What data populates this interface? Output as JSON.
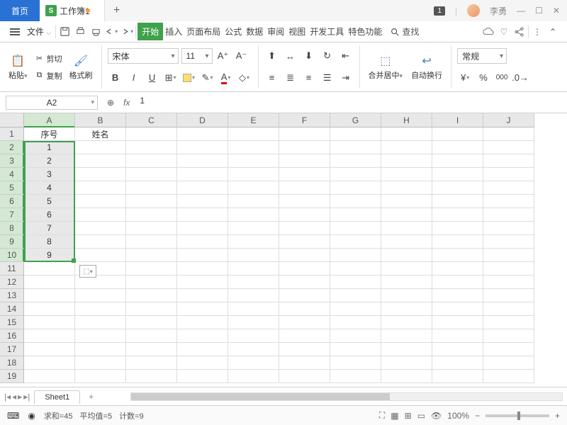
{
  "titlebar": {
    "home_label": "首页",
    "doc_name": "工作簿1",
    "doc_icon_letter": "S",
    "badge": "1",
    "user_name": "李勇"
  },
  "menubar": {
    "file_label": "文件",
    "tabs": [
      "开始",
      "插入",
      "页面布局",
      "公式",
      "数据",
      "审阅",
      "视图",
      "开发工具",
      "特色功能"
    ],
    "search_label": "查找"
  },
  "toolbar": {
    "paste": "粘贴",
    "cut": "剪切",
    "copy": "复制",
    "format_painter": "格式刷",
    "font_name": "宋体",
    "font_size": "11",
    "merge_center": "合并居中",
    "wrap_text": "自动换行",
    "number_format": "常规"
  },
  "namebox": {
    "ref": "A2",
    "formula": "1"
  },
  "grid": {
    "columns": [
      "A",
      "B",
      "C",
      "D",
      "E",
      "F",
      "G",
      "H",
      "I",
      "J"
    ],
    "rows": [
      1,
      2,
      3,
      4,
      5,
      6,
      7,
      8,
      9,
      10,
      11,
      12,
      13,
      14,
      15,
      16,
      17,
      18,
      19
    ],
    "header_row": [
      "序号",
      "姓名"
    ],
    "data_col_a": [
      "1",
      "2",
      "3",
      "4",
      "5",
      "6",
      "7",
      "8",
      "9"
    ],
    "selected_col": "A",
    "selected_rows": [
      2,
      10
    ]
  },
  "sheetbar": {
    "sheet_name": "Sheet1"
  },
  "statusbar": {
    "sum_label": "求和=",
    "sum_val": "45",
    "avg_label": "平均值=",
    "avg_val": "5",
    "count_label": "计数=",
    "count_val": "9",
    "zoom": "100%"
  }
}
